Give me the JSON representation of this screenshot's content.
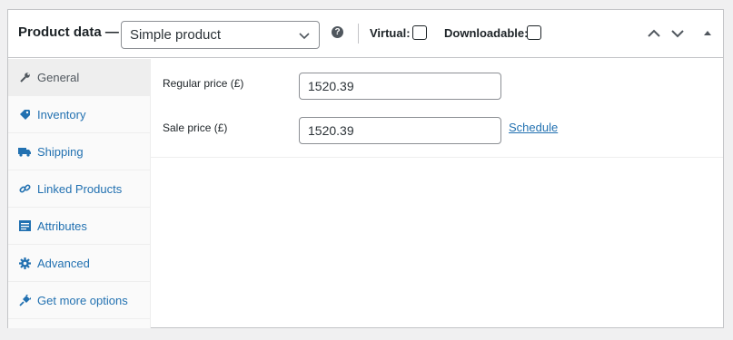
{
  "header": {
    "title": "Product data —",
    "product_type": "Simple product",
    "help_glyph": "?",
    "virtual_label": "Virtual:",
    "downloadable_label": "Downloadable:",
    "virtual_checked": false,
    "downloadable_checked": false
  },
  "sidebar": {
    "items": [
      {
        "label": "General",
        "icon": "wrench-icon",
        "active": true
      },
      {
        "label": "Inventory",
        "icon": "tag-icon",
        "active": false
      },
      {
        "label": "Shipping",
        "icon": "truck-icon",
        "active": false
      },
      {
        "label": "Linked Products",
        "icon": "link-icon",
        "active": false
      },
      {
        "label": "Attributes",
        "icon": "list-icon",
        "active": false
      },
      {
        "label": "Advanced",
        "icon": "gear-icon",
        "active": false
      },
      {
        "label": "Get more options",
        "icon": "plugin-icon",
        "active": false
      }
    ]
  },
  "general": {
    "regular_price_label": "Regular price (£)",
    "regular_price_value": "1520.39",
    "sale_price_label": "Sale price (£)",
    "sale_price_value": "1520.39",
    "schedule_link": "Schedule"
  },
  "colors": {
    "accent": "#2271b1",
    "border": "#c3c4c7",
    "active_tab": "#eeeeee"
  }
}
